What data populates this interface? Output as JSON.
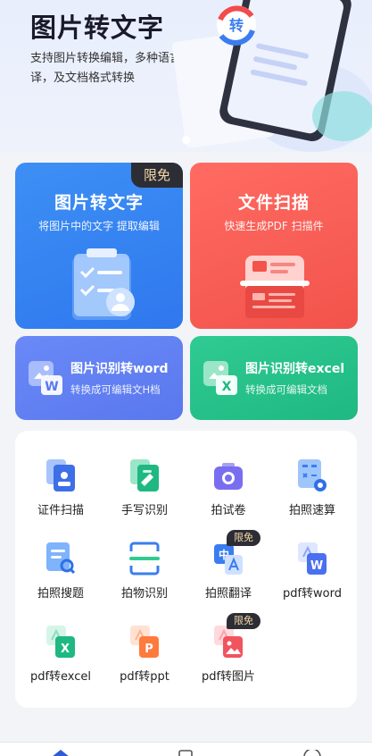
{
  "banner": {
    "title": "图片转文字",
    "desc": "支持图片转换编辑，多种语言翻译，及文档格式转换",
    "art_badge": "转"
  },
  "cards": {
    "img_to_text": {
      "title": "图片转文字",
      "subtitle": "将图片中的文字 提取编辑",
      "badge": "限免",
      "color": "#3483f2"
    },
    "file_scan": {
      "title": "文件扫描",
      "subtitle": "快速生成PDF 扫描件",
      "color": "#f75c53"
    },
    "img_to_word": {
      "title": "图片识别转word",
      "subtitle": "转换成可编辑文H档",
      "color": "#6482f4"
    },
    "img_to_excel": {
      "title": "图片识别转excel",
      "subtitle": "转换成可编辑文档",
      "color": "#27c28a"
    }
  },
  "tools": [
    {
      "label": "证件扫描",
      "icon": "id-card-icon"
    },
    {
      "label": "手写识别",
      "icon": "handwriting-icon"
    },
    {
      "label": "拍试卷",
      "icon": "camera-icon"
    },
    {
      "label": "拍照速算",
      "icon": "calculator-icon"
    },
    {
      "label": "拍照搜题",
      "icon": "search-question-icon"
    },
    {
      "label": "拍物识别",
      "icon": "object-scan-icon"
    },
    {
      "label": "拍照翻译",
      "icon": "translate-icon",
      "badge": "限免"
    },
    {
      "label": "pdf转word",
      "icon": "pdf-word-icon"
    },
    {
      "label": "pdf转excel",
      "icon": "pdf-excel-icon"
    },
    {
      "label": "pdf转ppt",
      "icon": "pdf-ppt-icon"
    },
    {
      "label": "pdf转图片",
      "icon": "pdf-image-icon",
      "badge": "限免"
    }
  ],
  "icon_letters": {
    "word": "W",
    "excel": "X",
    "ppt": "P",
    "translate": "中"
  }
}
